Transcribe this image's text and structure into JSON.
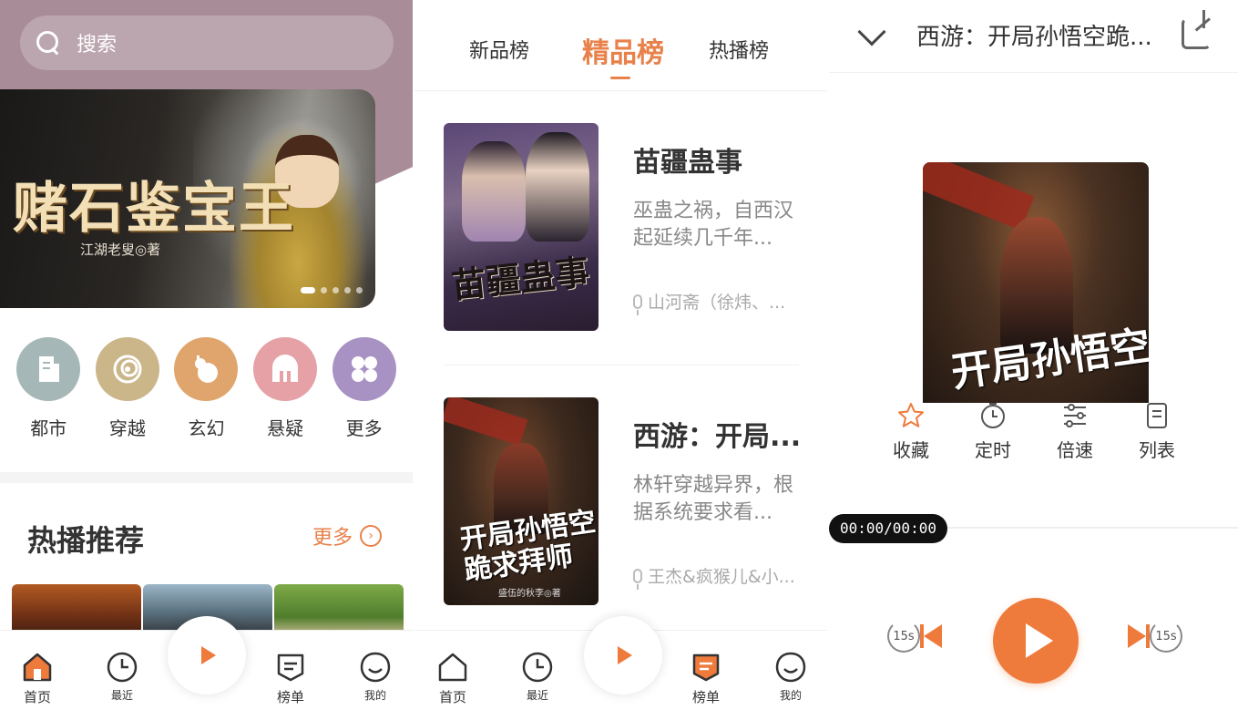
{
  "home": {
    "search_placeholder": "搜索",
    "banner": {
      "title": "赌石鉴宝王",
      "author": "江湖老叟◎著"
    },
    "categories": [
      {
        "label": "都市",
        "icon": "document-icon"
      },
      {
        "label": "穿越",
        "icon": "swirl-icon"
      },
      {
        "label": "玄幻",
        "icon": "gourd-icon"
      },
      {
        "label": "悬疑",
        "icon": "helmet-icon"
      },
      {
        "label": "更多",
        "icon": "clover-icon"
      }
    ],
    "section_title": "热播推荐",
    "more_label": "更多"
  },
  "nav": {
    "home": "首页",
    "recent": "最近",
    "rank": "榜单",
    "mine": "我的"
  },
  "rank": {
    "tabs": [
      "新品榜",
      "精品榜",
      "热播榜"
    ],
    "active_tab": "精品榜",
    "books": [
      {
        "title": "苗疆蛊事",
        "desc": "巫蛊之祸，自西汉起延续几千年...",
        "author": "山河斋（徐炜、...",
        "cover_title": "苗疆蛊事"
      },
      {
        "title": "西游：开局...",
        "desc": "林轩穿越异界，根据系统要求看...",
        "author": "王杰&疯猴儿&小...",
        "cover_title": "开局孙悟空跪求拜师",
        "cover_author": "盛伍的秋李◎著"
      }
    ]
  },
  "player": {
    "title": "西游：开局孙悟空跪...",
    "cover_title": "开局孙悟空",
    "actions": [
      "收藏",
      "定时",
      "倍速",
      "列表"
    ],
    "time": "00:00/00:00",
    "skip_back": "15s",
    "skip_forward": "15s"
  },
  "colors": {
    "accent": "#ee7a3b",
    "home_header": "#a88c98"
  }
}
